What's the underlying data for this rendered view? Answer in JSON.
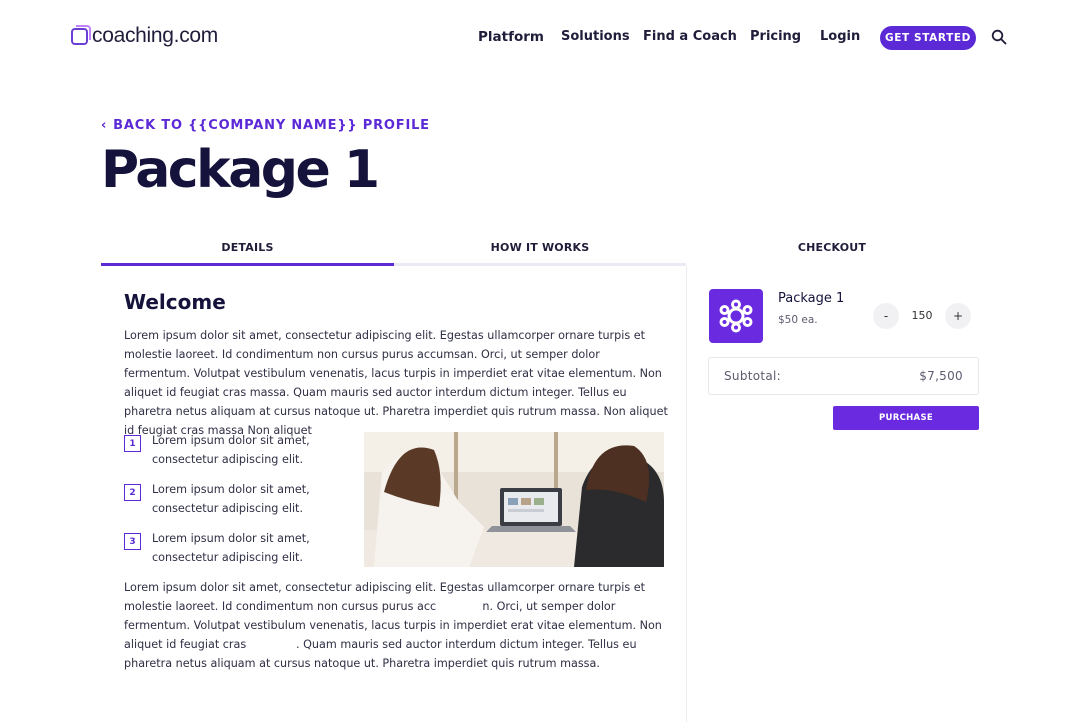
{
  "header": {
    "logo_text": "coaching.com",
    "nav": {
      "platform": "Platform",
      "solutions": "Solutions",
      "find_coach": "Find a Coach",
      "pricing": "Pricing",
      "login": "Login"
    },
    "cta_label": "GET STARTED",
    "search_icon": "search-icon"
  },
  "back_link": "BACK TO {{COMPANY NAME}} PROFILE",
  "page_title": "Package 1",
  "tabs": [
    {
      "label": "DETAILS",
      "active": true
    },
    {
      "label": "HOW IT WORKS",
      "active": false
    },
    {
      "label": "CHECKOUT",
      "active": false
    }
  ],
  "details": {
    "heading": "Welcome",
    "paragraph1": "Lorem ipsum dolor sit amet, consectetur adipiscing elit. Egestas ullamcorper ornare turpis et molestie laoreet. Id condimentum non cursus purus accumsan. Orci, ut semper dolor fermentum. Volutpat vestibulum venenatis, lacus turpis in imperdiet erat vitae elementum. Non aliquet id feugiat cras massa. Quam mauris sed auctor interdum dictum integer. Tellus eu pharetra netus aliquam at cursus natoque ut. Pharetra imperdiet quis rutrum massa. Non aliquet id feugiat cras massa Non aliquet",
    "list": [
      {
        "number": "1",
        "text": "Lorem ipsum dolor sit amet, consectetur adipiscing elit."
      },
      {
        "number": "2",
        "text": "Lorem ipsum dolor sit amet, consectetur adipiscing elit."
      },
      {
        "number": "3",
        "text": "Lorem ipsum dolor sit amet, consectetur adipiscing elit."
      }
    ],
    "paragraph2": "Lorem ipsum dolor sit amet, consectetur adipiscing elit. Egestas ullamcorper ornare turpis et molestie laoreet. Id condimentum non cursus purus acc             n. Orci, ut semper dolor fermentum. Volutpat vestibulum venenatis, lacus turpis in imperdiet erat vitae elementum. Non aliquet id feugiat cras              . Quam mauris sed auctor interdum dictum integer. Tellus eu pharetra netus aliquam at cursus natoque ut. Pharetra imperdiet quis rutrum massa."
  },
  "checkout": {
    "package_name": "Package 1",
    "unit_price": "$50 ea.",
    "minus_label": "-",
    "plus_label": "+",
    "quantity": "150",
    "subtotal_label": "Subtotal:",
    "subtotal_value": "$7,500",
    "purchase_label": "PURCHASE"
  },
  "colors": {
    "accent": "#5b2ad6",
    "package_icon_bg": "#6a2ae0",
    "title": "#15123b"
  }
}
